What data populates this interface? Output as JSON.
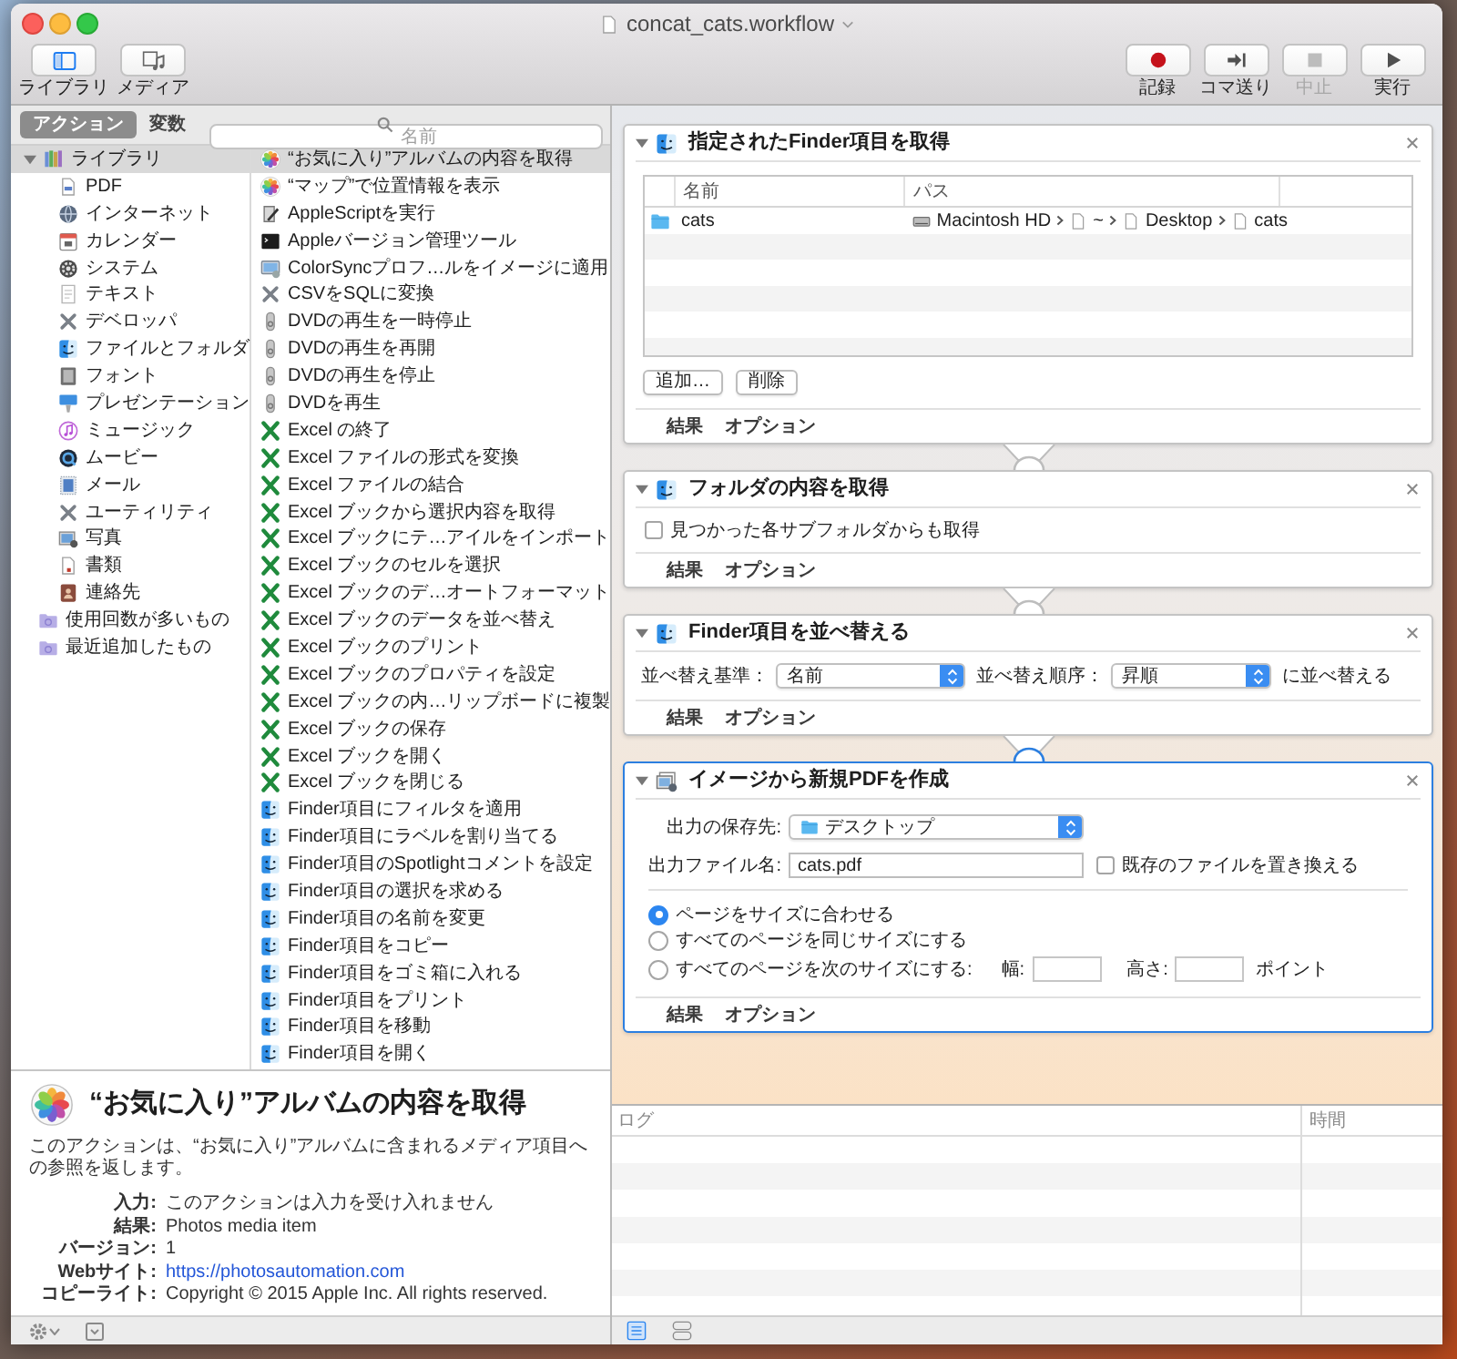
{
  "window": {
    "title": "concat_cats.workflow"
  },
  "toolbar": {
    "view_buttons": [
      {
        "kind": "library",
        "label": "ライブラリ",
        "selected": true
      },
      {
        "kind": "media",
        "label": "メディア",
        "selected": false
      }
    ],
    "run_buttons": [
      {
        "kind": "record",
        "label": "記録",
        "disabled": false
      },
      {
        "kind": "step",
        "label": "コマ送り",
        "disabled": false
      },
      {
        "kind": "stop",
        "label": "中止",
        "disabled": true
      },
      {
        "kind": "run",
        "label": "実行",
        "disabled": false
      }
    ]
  },
  "panel": {
    "tabs": [
      {
        "label": "アクション",
        "selected": true
      },
      {
        "label": "変数",
        "selected": false
      }
    ],
    "search": {
      "placeholder": "名前"
    }
  },
  "library": [
    {
      "label": "ライブラリ",
      "kind": "library",
      "expanded": true,
      "selected": true,
      "children": [
        {
          "label": "PDF",
          "kind": "pdf",
          "selected": false
        },
        {
          "label": "インターネット",
          "kind": "internet",
          "selected": false
        },
        {
          "label": "カレンダー",
          "kind": "calendar",
          "selected": false
        },
        {
          "label": "システム",
          "kind": "system",
          "selected": false
        },
        {
          "label": "テキスト",
          "kind": "text",
          "selected": false
        },
        {
          "label": "デベロッパ",
          "kind": "developer",
          "selected": false
        },
        {
          "label": "ファイルとフォルダ",
          "kind": "files",
          "selected": false
        },
        {
          "label": "フォント",
          "kind": "fonts",
          "selected": false
        },
        {
          "label": "プレゼンテーション",
          "kind": "presentation",
          "selected": false
        },
        {
          "label": "ミュージック",
          "kind": "music",
          "selected": false
        },
        {
          "label": "ムービー",
          "kind": "movies",
          "selected": false
        },
        {
          "label": "メール",
          "kind": "mail",
          "selected": false
        },
        {
          "label": "ユーティリティ",
          "kind": "utilities",
          "selected": false
        },
        {
          "label": "写真",
          "kind": "photo_lib",
          "selected": false
        },
        {
          "label": "書類",
          "kind": "documents",
          "selected": false
        },
        {
          "label": "連絡先",
          "kind": "contacts",
          "selected": false
        }
      ]
    },
    {
      "label": "使用回数が多いもの",
      "kind": "smart_folder",
      "selected": false
    },
    {
      "label": "最近追加したもの",
      "kind": "smart_folder",
      "selected": false
    }
  ],
  "actions": [
    {
      "label": "“お気に入り”アルバムの内容を取得",
      "kind": "photos",
      "selected": true
    },
    {
      "label": "“マップ”で位置情報を表示",
      "kind": "photos",
      "selected": false
    },
    {
      "label": "AppleScriptを実行",
      "kind": "applescript",
      "selected": false
    },
    {
      "label": "Appleバージョン管理ツール",
      "kind": "terminal",
      "selected": false
    },
    {
      "label": "ColorSyncプロフ…ルをイメージに適用",
      "kind": "colorsync",
      "selected": false
    },
    {
      "label": "CSVをSQLに変換",
      "kind": "tools",
      "selected": false
    },
    {
      "label": "DVDの再生を一時停止",
      "kind": "dvd",
      "selected": false
    },
    {
      "label": "DVDの再生を再開",
      "kind": "dvd",
      "selected": false
    },
    {
      "label": "DVDの再生を停止",
      "kind": "dvd",
      "selected": false
    },
    {
      "label": "DVDを再生",
      "kind": "dvd",
      "selected": false
    },
    {
      "label": "Excel の終了",
      "kind": "excel",
      "selected": false
    },
    {
      "label": "Excel ファイルの形式を変換",
      "kind": "excel",
      "selected": false
    },
    {
      "label": "Excel ファイルの結合",
      "kind": "excel",
      "selected": false
    },
    {
      "label": "Excel ブックから選択内容を取得",
      "kind": "excel",
      "selected": false
    },
    {
      "label": "Excel ブックにテ…アイルをインポート",
      "kind": "excel",
      "selected": false
    },
    {
      "label": "Excel ブックのセルを選択",
      "kind": "excel",
      "selected": false
    },
    {
      "label": "Excel ブックのデ…オートフォーマット",
      "kind": "excel",
      "selected": false
    },
    {
      "label": "Excel ブックのデータを並べ替え",
      "kind": "excel",
      "selected": false
    },
    {
      "label": "Excel ブックのプリント",
      "kind": "excel",
      "selected": false
    },
    {
      "label": "Excel ブックのプロパティを設定",
      "kind": "excel",
      "selected": false
    },
    {
      "label": "Excel ブックの内…リップボードに複製",
      "kind": "excel",
      "selected": false
    },
    {
      "label": "Excel ブックの保存",
      "kind": "excel",
      "selected": false
    },
    {
      "label": "Excel ブックを開く",
      "kind": "excel",
      "selected": false
    },
    {
      "label": "Excel ブックを閉じる",
      "kind": "excel",
      "selected": false
    },
    {
      "label": "Finder項目にフィルタを適用",
      "kind": "finder",
      "selected": false
    },
    {
      "label": "Finder項目にラベルを割り当てる",
      "kind": "finder",
      "selected": false
    },
    {
      "label": "Finder項目のSpotlightコメントを設定",
      "kind": "finder",
      "selected": false
    },
    {
      "label": "Finder項目の選択を求める",
      "kind": "finder",
      "selected": false
    },
    {
      "label": "Finder項目の名前を変更",
      "kind": "finder",
      "selected": false
    },
    {
      "label": "Finder項目をコピー",
      "kind": "finder",
      "selected": false
    },
    {
      "label": "Finder項目をゴミ箱に入れる",
      "kind": "finder",
      "selected": false
    },
    {
      "label": "Finder項目をプリント",
      "kind": "finder",
      "selected": false
    },
    {
      "label": "Finder項目を移動",
      "kind": "finder",
      "selected": false
    },
    {
      "label": "Finder項目を開く",
      "kind": "finder",
      "selected": false
    }
  ],
  "description": {
    "kind": "photos",
    "title": "“お気に入り”アルバムの内容を取得",
    "text": "このアクションは、“お気に入り”アルバムに含まれるメディア項目への参照を返します。",
    "fields": [
      {
        "kind": "text",
        "label": "入力:",
        "value": "このアクションは入力を受け入れません"
      },
      {
        "kind": "text",
        "label": "結果:",
        "value": "Photos media item"
      },
      {
        "kind": "text",
        "label": "バージョン:",
        "value": "1"
      },
      {
        "kind": "link",
        "label": "Webサイト:",
        "value": "https://photosautomation.com"
      },
      {
        "kind": "text",
        "label": "コピーライト:",
        "value": "Copyright © 2015 Apple Inc. All rights reserved."
      }
    ]
  },
  "workflow": {
    "actions": [
      {
        "kind": "file_list",
        "title": "指定されたFinder項目を取得",
        "expanded": true,
        "selected": false,
        "table": {
          "columns": [
            "名前",
            "パス"
          ],
          "rows": [
            {
              "kind": "folder",
              "name": "cats",
              "path": [
                {
                  "kind": "disk",
                  "label": "Macintosh HD"
                },
                {
                  "kind": "generic",
                  "label": "~"
                },
                {
                  "kind": "generic",
                  "label": "Desktop"
                },
                {
                  "kind": "generic",
                  "label": "cats"
                }
              ]
            }
          ]
        },
        "buttons": [
          "追加…",
          "削除"
        ],
        "footer": [
          "結果",
          "オプション"
        ]
      },
      {
        "kind": "options",
        "title": "フォルダの内容を取得",
        "expanded": true,
        "selected": false,
        "options": [
          {
            "label": "見つかった各サブフォルダからも取得",
            "checked": false
          }
        ],
        "footer": [
          "結果",
          "オプション"
        ]
      },
      {
        "kind": "sort",
        "title": "Finder項目を並べ替える",
        "expanded": true,
        "selected": false,
        "sort_by": {
          "label": "並べ替え基準：",
          "value": "名前"
        },
        "order": {
          "label": "並べ替え順序：",
          "value": "昇順"
        },
        "suffix": "に並べ替える",
        "footer": [
          "結果",
          "オプション"
        ]
      },
      {
        "kind": "pdf",
        "title": "イメージから新規PDFを作成",
        "expanded": true,
        "selected": true,
        "save_to": {
          "label": "出力の保存先:",
          "value": "デスクトップ"
        },
        "file_name": {
          "label": "出力ファイル名:",
          "value": "cats.pdf"
        },
        "replace": {
          "label": "既存のファイルを置き換える",
          "checked": false
        },
        "layout": [
          {
            "label": "ページをサイズに合わせる",
            "selected": true
          },
          {
            "label": "すべてのページを同じサイズにする",
            "selected": false
          },
          {
            "label": "すべてのページを次のサイズにする:",
            "selected": false
          }
        ],
        "size_fields": [
          {
            "label": "幅:"
          },
          {
            "label": "高さ:"
          }
        ],
        "unit": "ポイント",
        "footer": [
          "結果",
          "オプション"
        ]
      }
    ]
  },
  "log": {
    "columns": [
      "ログ",
      "時間"
    ],
    "view_buttons": [
      {
        "kind": "list",
        "selected": true
      },
      {
        "kind": "split",
        "selected": false
      }
    ]
  }
}
